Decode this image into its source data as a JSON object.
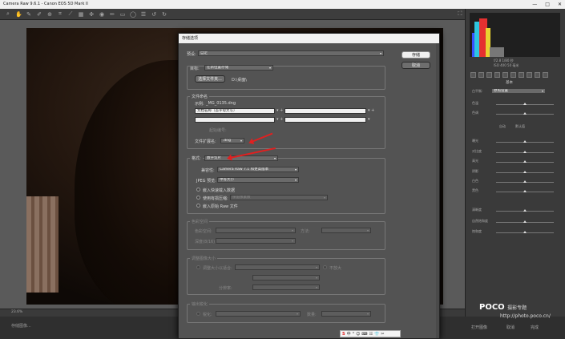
{
  "app": {
    "title": "Camera Raw 9.6.1 - Canon EOS 5D Mark II",
    "window_buttons": [
      "—",
      "□",
      "✕"
    ]
  },
  "toolbar": {
    "icons": [
      "zoom-icon",
      "hand-icon",
      "white-balance-icon",
      "color-sampler-icon",
      "target-icon",
      "crop-icon",
      "straighten-icon",
      "transform-icon",
      "spot-removal-icon",
      "red-eye-icon",
      "brush-icon",
      "graduated-filter-icon",
      "radial-filter-icon",
      "preferences-icon",
      "rotate-left-icon",
      "rotate-right-icon"
    ]
  },
  "statusbar": {
    "zoom": "23.6%"
  },
  "right_panel": {
    "histogram_readout_1": "f/2.8   1/80 秒",
    "histogram_readout_2": "ISO 400   50 毫米",
    "section_title": "基本",
    "profile_label": "白平衡:",
    "profile_value": "原照设置",
    "sliders": [
      {
        "label": "色温",
        "level": 0.5
      },
      {
        "label": "色调",
        "level": 0.5
      },
      {
        "label": "曝光",
        "level": 0.5
      },
      {
        "label": "对比度",
        "level": 0.5
      },
      {
        "label": "高光",
        "level": 0.5
      },
      {
        "label": "阴影",
        "level": 0.5
      },
      {
        "label": "白色",
        "level": 0.5
      },
      {
        "label": "黑色",
        "level": 0.5
      },
      {
        "label": "清晰度",
        "level": 0.5
      },
      {
        "label": "自然饱和度",
        "level": 0.5
      },
      {
        "label": "饱和度",
        "level": 0.5
      }
    ],
    "auto_label": "自动",
    "default_label": "默认值"
  },
  "bottom": {
    "workflow_label": "存储图像...",
    "open_image": "打开图像",
    "cancel": "取消",
    "done": "完成"
  },
  "watermark": {
    "brand": "POCO",
    "brand_cn": "摄影专题",
    "url": "http://photo.poco.cn/"
  },
  "dialog": {
    "title": "存储选项",
    "preset_label": "预设:",
    "preset_value": "自定",
    "save_button": "存储",
    "cancel_button": "取消",
    "destination": {
      "label": "目标:",
      "value": "在新位置存储",
      "choose_folder": "选择文件夹...",
      "folder_path": "D:\\桌面\\"
    },
    "file_naming": {
      "group": "文件命名",
      "example_label": "示例:",
      "example_value": "_MG_0135.dng",
      "name_part_1": "文档名称（首字母大写）",
      "name_part_2": "",
      "name_part_3": "",
      "name_part_4": "",
      "begin_numbering_label": "起始编号:",
      "extension_label": "文件扩展名:",
      "extension_value": ".dng"
    },
    "format": {
      "label": "格式:",
      "value": "数字负片",
      "compat_label": "兼容性:",
      "compat_value": "Camera Raw 7.1 和更高版本",
      "jpeg_preview_label": "JPEG 预览:",
      "jpeg_preview_value": "中等大小",
      "embed_fast_load": "嵌入快速载入数据",
      "lossy_compression": "使用有损压缩:",
      "lossy_value": "保留像素数",
      "embed_original_raw": "嵌入原始 Raw 文件"
    },
    "color_space": {
      "group": "色彩空间",
      "space_label": "色彩空间:",
      "intent_label": "方法:",
      "depth_label": "深度(8/16):"
    },
    "image_sizing": {
      "group": "调整图像大小",
      "resize_label": "调整大小以适合:",
      "no_enlarge": "不放大",
      "resolution_label": "分辨率:"
    },
    "sharpen": {
      "group": "输出锐化",
      "sharpen_label": "锐化:",
      "amount_label": "数量:"
    }
  },
  "ime_bar": {
    "items": [
      "S",
      "中",
      "°",
      "☺",
      "⌨",
      "☷",
      "👕",
      "✂"
    ]
  },
  "colors": {
    "accent_red": "#e02020",
    "dialog_bg": "#535353"
  }
}
